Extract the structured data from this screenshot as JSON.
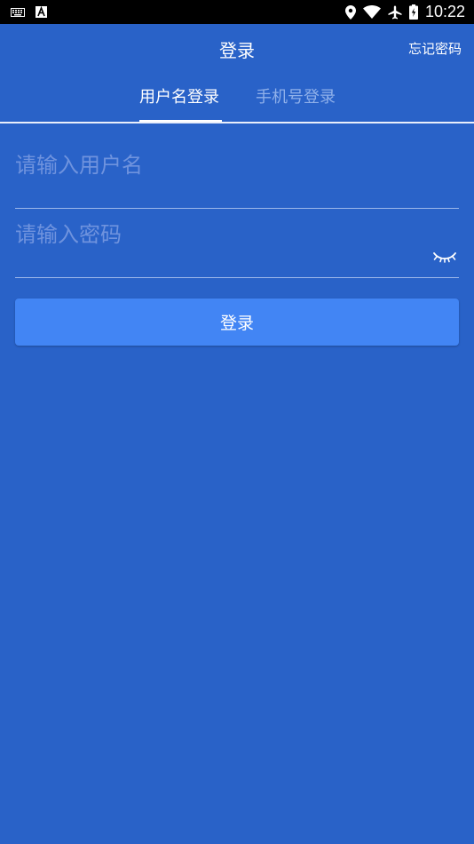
{
  "status_bar": {
    "time": "10:22",
    "left_icons": [
      "keyboard-icon",
      "text-a-icon"
    ],
    "right_icons": [
      "location-icon",
      "wifi-icon",
      "airplane-icon",
      "battery-icon"
    ]
  },
  "app_bar": {
    "title": "登录",
    "forgot_password": "忘记密码"
  },
  "tabs": [
    {
      "label": "用户名登录",
      "active": true
    },
    {
      "label": "手机号登录",
      "active": false
    }
  ],
  "form": {
    "username_placeholder": "请输入用户名",
    "username_value": "",
    "password_placeholder": "请输入密码",
    "password_value": "",
    "password_toggle_icon": "eye-closed-icon",
    "submit_label": "登录"
  },
  "colors": {
    "background": "#2962c8",
    "button": "#4285f4",
    "inactive_tab": "#8fb0ea",
    "placeholder": "#6f93de"
  }
}
